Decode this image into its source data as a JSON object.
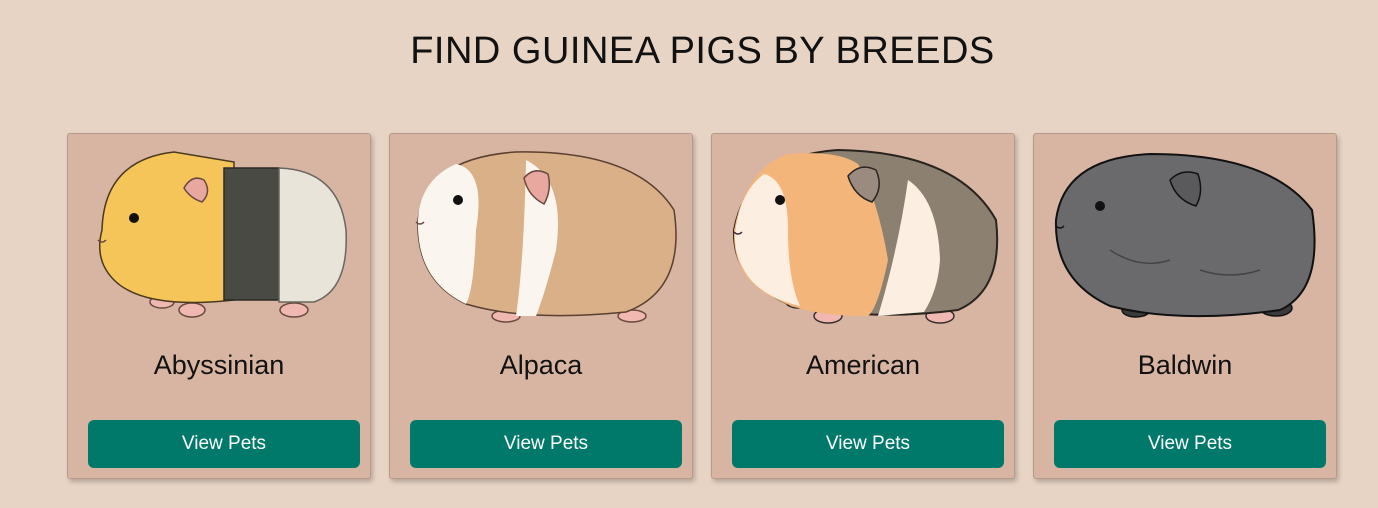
{
  "page": {
    "heading": "FIND GUINEA PIGS BY BREEDS"
  },
  "colors": {
    "background": "#e8d4c5",
    "card": "#d8b4a2",
    "button": "#00796b",
    "button_text": "#ffffff"
  },
  "breeds": [
    {
      "name": "Abyssinian",
      "button_label": "View Pets",
      "icon": "abyssinian-guinea-pig-illustration"
    },
    {
      "name": "Alpaca",
      "button_label": "View Pets",
      "icon": "alpaca-guinea-pig-illustration"
    },
    {
      "name": "American",
      "button_label": "View Pets",
      "icon": "american-guinea-pig-illustration"
    },
    {
      "name": "Baldwin",
      "button_label": "View Pets",
      "icon": "baldwin-guinea-pig-illustration"
    }
  ]
}
